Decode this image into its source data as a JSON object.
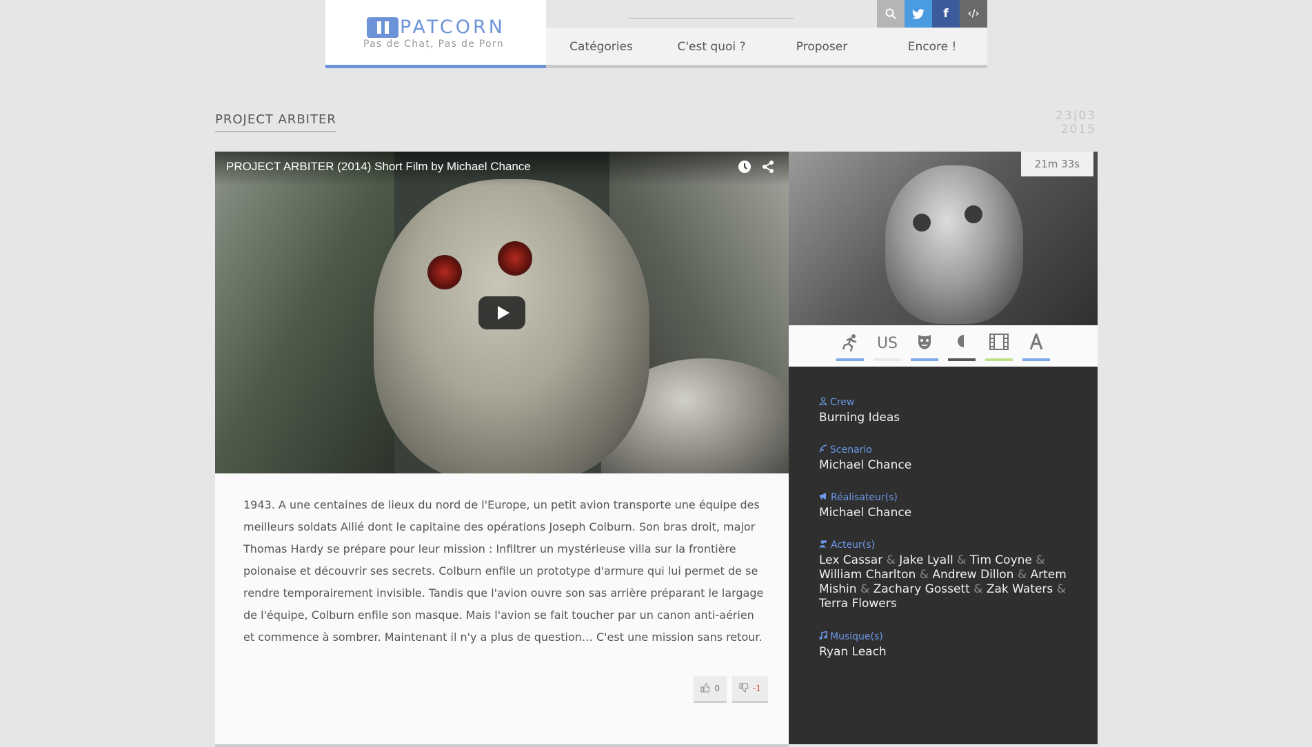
{
  "header": {
    "logo_text": "PATCORN",
    "tagline": "Pas de Chat, Pas de Porn",
    "nav": [
      "Catégories",
      "C'est quoi ?",
      "Proposer",
      "Encore !"
    ]
  },
  "page": {
    "title": "PROJECT ARBITER",
    "date_day": "23|03",
    "date_year": "2015"
  },
  "video": {
    "title": "PROJECT ARBITER (2014) Short Film by Michael Chance"
  },
  "description": "1943. A une centaines de lieux du nord de l'Europe, un petit avion transporte une équipe des meilleurs soldats Allié dont le capitaine des opérations Joseph Colburn. Son bras droit, major Thomas Hardy se prépare pour leur mission : Infiltrer un mystérieuse villa sur la frontière polonaise et découvrir ses secrets. Colburn enfile un prototype d'armure qui lui permet de se rendre temporairement invisible. Tandis que l'avion ouvre son sas arrière préparant le largage de l'équipe, Colburn enfile son masque. Mais l'avion se fait toucher par un canon anti-aérien et commence à sombrer. Maintenant il n'y a plus de question… C'est une mission sans retour.",
  "votes": {
    "up": "0",
    "down": "-1"
  },
  "sidebar": {
    "duration": "21m 33s",
    "tags": [
      {
        "icon": "runner-icon",
        "text": "",
        "color": "#7fa9e4"
      },
      {
        "icon": "country",
        "text": "US",
        "color": "#e9e9e9"
      },
      {
        "icon": "mask-icon",
        "text": "",
        "color": "#7fa9e4"
      },
      {
        "icon": "half-moon-icon",
        "text": "",
        "color": "#555555"
      },
      {
        "icon": "film-icon",
        "text": "",
        "color": "#bfe08a"
      },
      {
        "icon": "letter-a-icon",
        "text": "",
        "color": "#7fa9e4"
      }
    ],
    "crew_label": "Crew",
    "crew": "Burning Ideas",
    "scenario_label": "Scenario",
    "scenario": "Michael Chance",
    "directors_label": "Réalisateur(s)",
    "directors": "Michael Chance",
    "actors_label": "Acteur(s)",
    "actors": [
      "Lex Cassar",
      "Jake Lyall",
      "Tim Coyne",
      "William Charlton",
      "Andrew Dillon",
      "Artem Mishin",
      "Zachary Gossett",
      "Zak Waters",
      "Terra Flowers"
    ],
    "amp": "&",
    "music_label": "Musique(s)",
    "music": "Ryan Leach"
  }
}
